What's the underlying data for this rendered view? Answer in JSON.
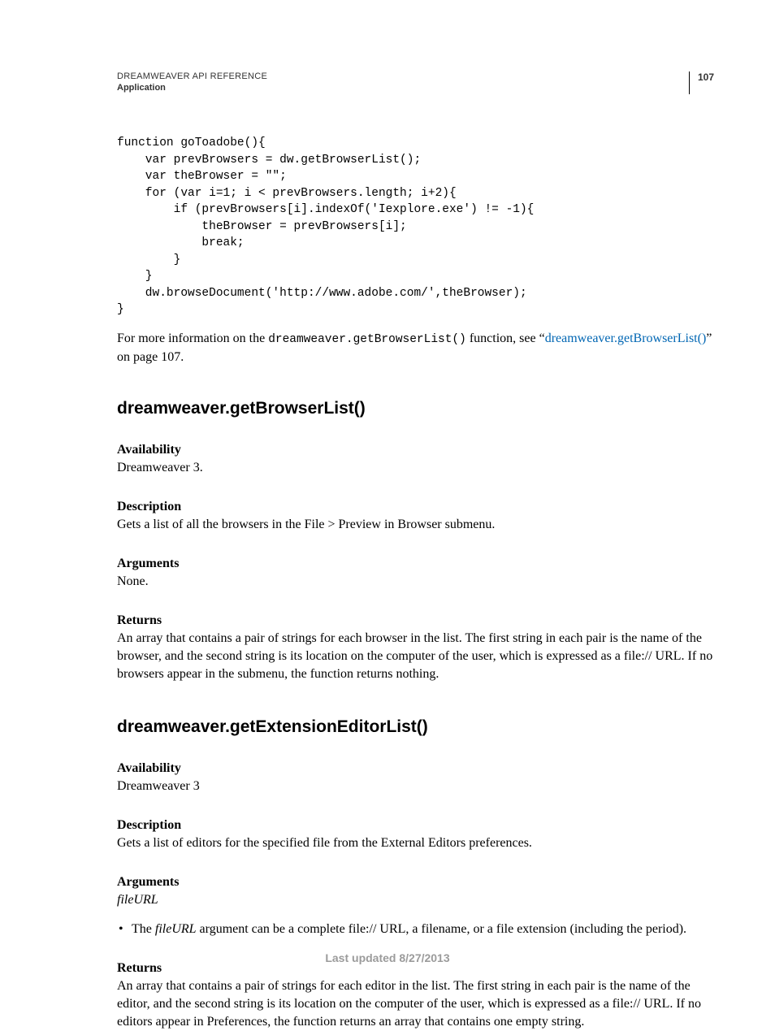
{
  "header": {
    "doc_title": "DREAMWEAVER API REFERENCE",
    "section": "Application",
    "page_number": "107"
  },
  "code_block": "function goToadobe(){\n    var prevBrowsers = dw.getBrowserList();\n    var theBrowser = \"\";\n    for (var i=1; i < prevBrowsers.length; i+2){\n        if (prevBrowsers[i].indexOf('Iexplore.exe') != -1){\n            theBrowser = prevBrowsers[i];\n            break;\n        }\n    }\n    dw.browseDocument('http://www.adobe.com/',theBrowser);\n}",
  "para1": {
    "pre": "For more information on the ",
    "code": "dreamweaver.getBrowserList()",
    "mid": " function, see “",
    "link": "dreamweaver.getBrowserList()",
    "post": "” on page 107."
  },
  "sec1": {
    "heading": "dreamweaver.getBrowserList()",
    "availability_label": "Availability",
    "availability_text": "Dreamweaver 3.",
    "description_label": "Description",
    "description_text": "Gets a list of all the browsers in the File > Preview in Browser submenu.",
    "arguments_label": "Arguments",
    "arguments_text": "None.",
    "returns_label": "Returns",
    "returns_text": "An array that contains a pair of strings for each browser in the list. The first string in each pair is the name of the browser, and the second string is its location on the computer of the user, which is expressed as a file:// URL. If no browsers appear in the submenu, the function returns nothing."
  },
  "sec2": {
    "heading": "dreamweaver.getExtensionEditorList()",
    "availability_label": "Availability",
    "availability_text": "Dreamweaver 3",
    "description_label": "Description",
    "description_text": "Gets a list of editors for the specified file from the External Editors preferences.",
    "arguments_label": "Arguments",
    "arguments_text": "fileURL",
    "bullet_pre": "The ",
    "bullet_em": "fileURL",
    "bullet_post": " argument can be a complete file:// URL, a filename, or a file extension (including the period).",
    "returns_label": "Returns",
    "returns_text": "An array that contains a pair of strings for each editor in the list. The first string in each pair is the name of the editor, and the second string is its location on the computer of the user, which is expressed as a file:// URL. If no editors appear in Preferences, the function returns an array that contains one empty string."
  },
  "footer": "Last updated 8/27/2013"
}
